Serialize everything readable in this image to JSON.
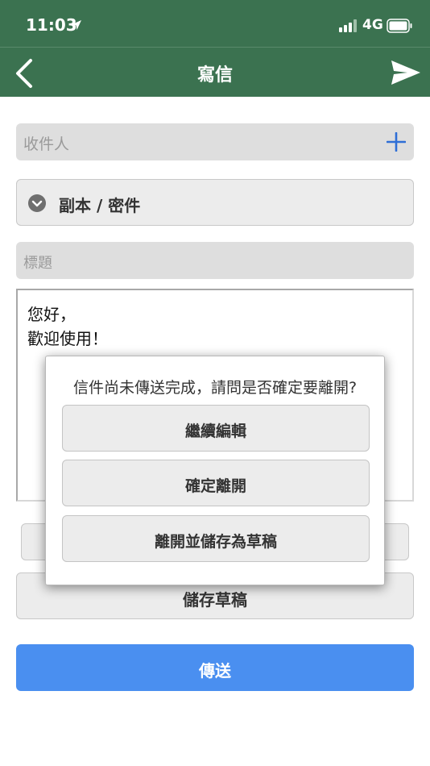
{
  "status_bar": {
    "time": "11:03",
    "network": "4G",
    "location_icon": "location-arrow-icon",
    "signal_icon": "signal-bars-icon",
    "battery_icon": "battery-icon"
  },
  "nav": {
    "title": "寫信",
    "back_icon": "chevron-left-icon",
    "send_icon": "paper-plane-icon"
  },
  "form": {
    "recipient_placeholder": "收件人",
    "add_recipient_icon": "plus-icon",
    "cc_label": "副本 / 密件",
    "cc_icon": "chevron-down-circle-icon",
    "subject_placeholder": "標題",
    "body_lines": [
      "您好，",
      "歡迎使用！"
    ]
  },
  "buttons": {
    "save_draft": "儲存草稿",
    "send": "傳送"
  },
  "dialog": {
    "message": "信件尚未傳送完成，請問是否確定要離開?",
    "options": [
      "繼續編輯",
      "確定離開",
      "離開並儲存為草稿"
    ]
  },
  "colors": {
    "header_green": "#3b7250",
    "send_blue": "#4a8ff0",
    "plus_blue": "#2f6fd6"
  }
}
